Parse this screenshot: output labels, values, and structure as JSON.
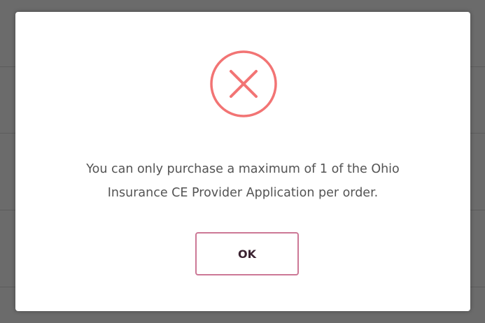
{
  "dialog": {
    "icon": "error-x-circle-icon",
    "icon_color": "#f27474",
    "message_line1": "You can only purchase a maximum of 1 of the Ohio",
    "message_line2": "Insurance CE Provider Application per order.",
    "ok_label": "OK",
    "ok_border_color": "#cc7896"
  }
}
